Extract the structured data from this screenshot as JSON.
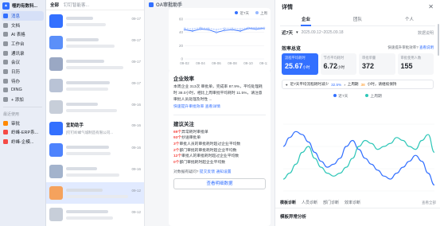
{
  "nav": {
    "org_name": "噬的有数科...",
    "items": [
      {
        "label": "消息",
        "active": true
      },
      {
        "label": "文档"
      },
      {
        "label": "AI 表格"
      },
      {
        "label": "工作台"
      },
      {
        "label": "通讯录"
      },
      {
        "label": "会议"
      },
      {
        "label": "日历"
      },
      {
        "label": "待办"
      },
      {
        "label": "DING"
      },
      {
        "label": "+ 添加"
      }
    ],
    "section_label": "最近使用",
    "recent": [
      {
        "label": "审批"
      },
      {
        "label": "岭峰-ERP系..."
      },
      {
        "label": "岭峰-企模..."
      }
    ]
  },
  "chatlist": {
    "tabs": [
      "全部",
      "钉钉智能客..."
    ],
    "items": [
      {
        "title": "",
        "time": "09-17",
        "color": "#3370ff"
      },
      {
        "title": "",
        "time": "09-17",
        "color": "#5b8ff9"
      },
      {
        "title": "",
        "time": "09-17",
        "color": "#9aa8c4"
      },
      {
        "title": "",
        "time": "09-17",
        "color": "#b9c3d6"
      },
      {
        "title": "",
        "time": "09-16",
        "color": "#c7ced9"
      },
      {
        "title": "宜助助手",
        "subtitle": "[钉钉岭峰气城制造有限公司...",
        "time": "09-16",
        "color": "#3370ff"
      },
      {
        "title": "",
        "time": "09-16",
        "color": "#4e83fd"
      },
      {
        "title": "",
        "time": "09-16",
        "color": "#a3b3cc"
      },
      {
        "title": "",
        "time": "09-12",
        "color": "#f5a25d",
        "selected": true
      },
      {
        "title": "",
        "time": "09-12",
        "color": "#c7ced9"
      }
    ]
  },
  "middle": {
    "header": "OA审批助手",
    "chart_legend": [
      "近7天",
      "上周"
    ],
    "chart_ylabels": [
      "60",
      "40",
      "20",
      "0"
    ],
    "chart_xlabels": [
      "09-02",
      "09-04",
      "09-06",
      "09-08",
      "09-10",
      "09-12"
    ],
    "efficiency_title": "企业效率",
    "efficiency_text": "本周企业 313次 审批单，完成率 87.9%，平均处理耗时 38.0小时，相比上周审批平均耗时 11.5%，请注意审批人员处理及时性 ...",
    "efficiency_links": [
      "快速提升审批效率",
      "查看详情"
    ],
    "suggest_title": "建议关注",
    "suggestions": [
      {
        "n": "69个",
        "text": "异常耗时审批单"
      },
      {
        "n": "93个",
        "text": "抄送审批单"
      },
      {
        "n": "3个",
        "text": "审批人员的审批耗时超过企业平均数"
      },
      {
        "n": "2个",
        "text": "部门审批的审批耗时超企业平均数"
      },
      {
        "n": "12个",
        "text": "审批人的审批耗时超过企业平均数"
      },
      {
        "n": "0个",
        "text": "部门审批耗时超企业平均数"
      }
    ],
    "feedback": "对数据有疑问?",
    "feedback_links": [
      "提交反馈",
      "通知设置"
    ],
    "view_button": "查看明细数据"
  },
  "detail": {
    "title": "详情",
    "tabs": [
      "企业",
      "团队",
      "个人"
    ],
    "range": "近7天",
    "dates": "2025.09.12~2025.09.18",
    "spec": "数据说明",
    "section": "效率总览",
    "quick": "快速提升审批效率?",
    "quick_link": "查看说明",
    "metrics": [
      {
        "label": "流程平均耗时",
        "value": "25.67",
        "unit": "小时",
        "highlight": true
      },
      {
        "label": "节点平均耗时",
        "value": "6.72",
        "unit": "小时"
      },
      {
        "label": "审批单量",
        "value": "372",
        "unit": ""
      },
      {
        "label": "审批使用人数",
        "value": "155",
        "unit": ""
      }
    ],
    "notice_prefix": "近7天平均流程耗时减少",
    "notice_pct": "32.5%",
    "notice_mid": "，上周期",
    "notice_hours": "38",
    "notice_suffix": "小时，请继续保持",
    "subtabs": [
      "模板诊断",
      "人员诊断",
      "部门诊断",
      "效率诊断"
    ],
    "more": "查看全部",
    "bottom_title": "模板异常分析"
  },
  "chart_data": [
    {
      "type": "line",
      "x": [
        "09-02",
        "09-03",
        "09-04",
        "09-05",
        "09-06",
        "09-07",
        "09-08",
        "09-09",
        "09-10",
        "09-11",
        "09-12"
      ],
      "series": [
        {
          "name": "近7天",
          "values": [
            44,
            42,
            45,
            44,
            40,
            43,
            44,
            42,
            46,
            45,
            46
          ]
        },
        {
          "name": "上周",
          "values": [
            46,
            45,
            47,
            46,
            44,
            46,
            46,
            45,
            47,
            47,
            47
          ]
        }
      ],
      "ylim": [
        0,
        60
      ],
      "colors": [
        "#3370ff",
        "#97b8ff"
      ]
    },
    {
      "type": "line",
      "series": [
        {
          "name": "近7天",
          "values": [
            30,
            36,
            40,
            38,
            33,
            26,
            20,
            16,
            18,
            22,
            30,
            34,
            28,
            22,
            18,
            14,
            10,
            8,
            12,
            16,
            20,
            24,
            20,
            12,
            4
          ]
        },
        {
          "name": "上周期",
          "values": [
            8,
            12,
            18,
            26,
            30,
            22,
            16,
            12,
            10,
            12,
            16,
            22,
            30,
            34,
            32,
            28,
            30,
            32,
            36,
            34,
            30,
            28,
            34,
            38,
            26
          ]
        }
      ],
      "ylim": [
        0,
        45
      ],
      "colors": [
        "#3370ff",
        "#2fc7b8"
      ]
    }
  ]
}
